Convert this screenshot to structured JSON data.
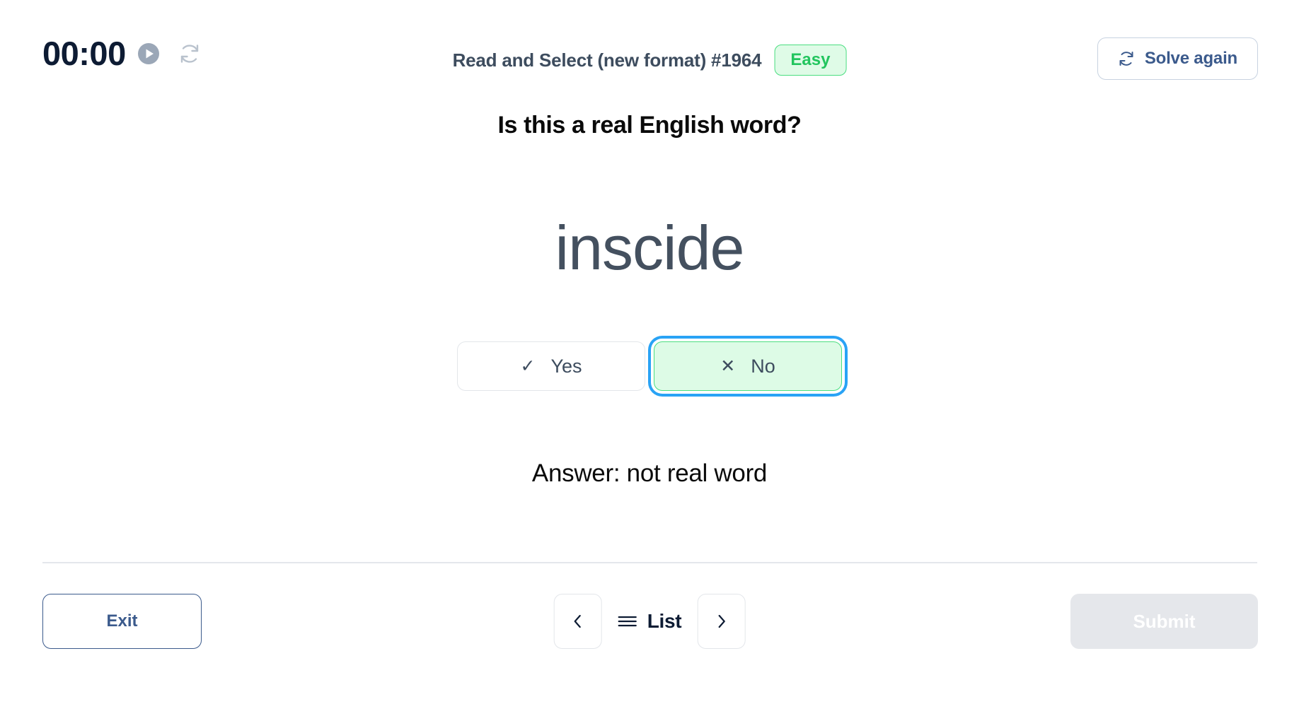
{
  "header": {
    "timer": "00:00",
    "play_icon": "play-circle-icon",
    "reset_icon": "reset-icon",
    "title": "Read and Select (new format) #1964",
    "difficulty_badge": "Easy",
    "solve_again_label": "Solve again",
    "solve_again_icon": "refresh-icon"
  },
  "main": {
    "question": "Is this a real English word?",
    "word": "inscide",
    "choices": [
      {
        "label": "Yes",
        "glyph": "✓",
        "icon_name": "check-icon",
        "selected": false
      },
      {
        "label": "No",
        "glyph": "✕",
        "icon_name": "cross-icon",
        "selected": true
      }
    ],
    "answer": "Answer: not real word"
  },
  "footer": {
    "exit_label": "Exit",
    "prev_icon": "chevron-left-icon",
    "list_label": "List",
    "list_icon": "hamburger-icon",
    "next_icon": "chevron-right-icon",
    "submit_label": "Submit"
  },
  "colors": {
    "accent_navy": "#3b5a8c",
    "timer_navy": "#0d1b33",
    "title_slate": "#3d4c5e",
    "badge_green_text": "#22c55e",
    "badge_green_bg": "#dffbe7",
    "badge_green_border": "#4ade80",
    "focus_blue": "#29a3f5",
    "word_slate": "#44505f",
    "disabled_gray": "#e5e7eb",
    "divider_gray": "#e4e7ec"
  }
}
